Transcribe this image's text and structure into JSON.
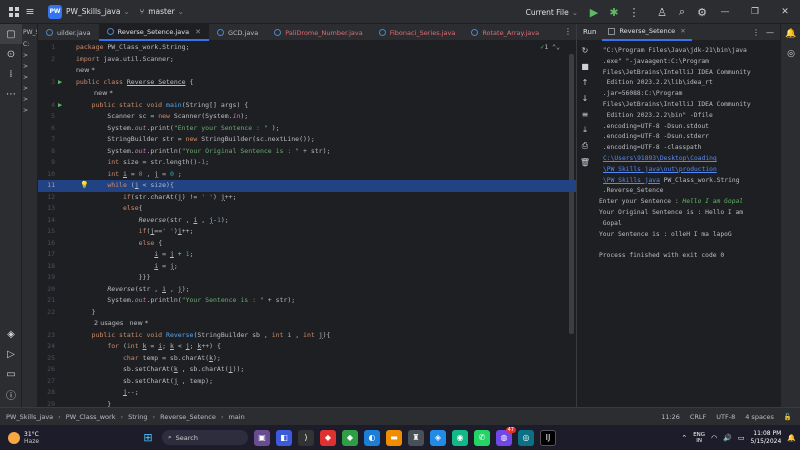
{
  "titlebar": {
    "project_badge": "PW",
    "project_name": "PW_Skills_java",
    "branch": "master",
    "run_config": "Current File",
    "icons": [
      "windows-icon",
      "hamburger-icon",
      "branch-icon",
      "run-icon",
      "debug-icon",
      "more-icon",
      "user-add-icon",
      "search-icon",
      "settings-icon"
    ]
  },
  "project_panel": {
    "label": "PW_S",
    "rows": [
      "C:",
      ">",
      ">",
      ">",
      ">",
      ">",
      ">"
    ]
  },
  "tabs": [
    {
      "label": "uilder.java",
      "active": false
    },
    {
      "label": "Reverse_Setence.java",
      "active": true
    },
    {
      "label": "GCD.java",
      "active": false
    },
    {
      "label": "PaliDrome_Number.java",
      "active": false
    },
    {
      "label": "Fibonaci_Series.java",
      "active": false
    },
    {
      "label": "Rotate_Array.java",
      "active": false
    }
  ],
  "inspection": {
    "count": "1",
    "warnings": "1"
  },
  "code": {
    "l1": "1",
    "l2": "2",
    "l3": "3",
    "l4": "4",
    "l5": "5",
    "l6": "6",
    "l7": "7",
    "l8": "8",
    "l9": "9",
    "l10": "10",
    "l11": "11",
    "l12": "12",
    "l13": "13",
    "l14": "14",
    "l15": "15",
    "l16": "16",
    "l17": "17",
    "l18": "18",
    "l19": "19",
    "l20": "20",
    "l21": "21",
    "l22": "22",
    "l23": "23",
    "l24": "24",
    "l25": "25",
    "l26": "26",
    "l27": "27",
    "l28": "28",
    "l29": "29",
    "hint_new1": "new *",
    "hint_new2": "new *",
    "hint_usages": "2 usages   new *"
  },
  "run": {
    "panel_label": "Run",
    "tab_label": "Reverse_Setence",
    "console": [
      " \"C:\\Program Files\\Java\\jdk-21\\bin\\java",
      " .exe\" \"-javaagent:C:\\Program",
      " Files\\JetBrains\\IntelliJ IDEA Community",
      "  Edition 2023.2.2\\lib\\idea_rt",
      " .jar=56088:C:\\Program",
      " Files\\JetBrains\\IntelliJ IDEA Community",
      "  Edition 2023.2.2\\bin\" -Dfile",
      " .encoding=UTF-8 -Dsun.stdout",
      " .encoding=UTF-8 -Dsun.stderr",
      " .encoding=UTF-8 -classpath"
    ],
    "link1": "C:\\Users\\91893\\Desktop\\Coading",
    "link2": "\\PW_Skills_java\\out\\production",
    "link3": "\\PW_Skills_java",
    "link3_tail": " PW_Class_work.String",
    "class_line": " .Reverse_Setence",
    "prompt": "Enter your Sentence : ",
    "input": "Hello I am Gopal",
    "original1": "Your Original Sentence is : Hello I am",
    "original2": " Gopal",
    "result": "Your Sentence is : olleH I ma lapoG",
    "finished": "Process finished with exit code 0"
  },
  "statusbar": {
    "crumbs": [
      "PW_Skills_java",
      "PW_Class_work",
      "String",
      "Reverse_Setence",
      "main"
    ],
    "position": "11:26",
    "line_sep": "CRLF",
    "encoding": "UTF-8",
    "indent": "4 spaces"
  },
  "taskbar": {
    "temp": "31°C",
    "weather": "Haze",
    "search_placeholder": "Search",
    "time": "11:08 PM",
    "date": "5/15/2024",
    "lang": "ENG\nIN",
    "badge1": "1",
    "badge2": "47"
  }
}
